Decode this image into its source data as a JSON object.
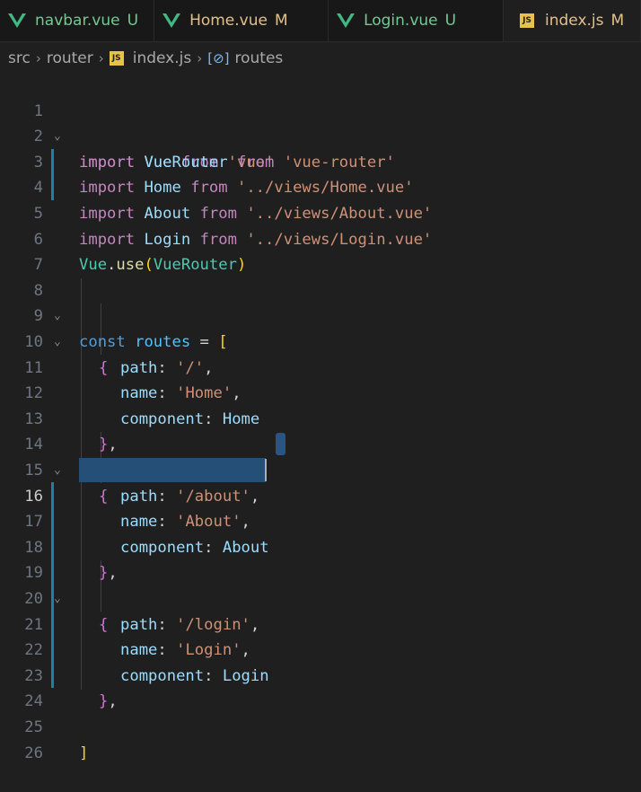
{
  "tabs": [
    {
      "name": "navbar.vue",
      "status": "U",
      "kind": "vue",
      "state": "u"
    },
    {
      "name": "Home.vue",
      "status": "M",
      "kind": "vue",
      "state": "m"
    },
    {
      "name": "Login.vue",
      "status": "U",
      "kind": "vue",
      "state": "u"
    },
    {
      "name": "index.js",
      "status": "M",
      "kind": "js",
      "state": "act"
    }
  ],
  "breadcrumb": {
    "segments": [
      "src",
      "router",
      "index.js",
      "routes"
    ],
    "file_icon": "JS"
  },
  "editor": {
    "current_line": 16,
    "lines": [
      {
        "n": "1"
      },
      {
        "n": "2"
      },
      {
        "n": "3"
      },
      {
        "n": "4"
      },
      {
        "n": "5"
      },
      {
        "n": "6"
      },
      {
        "n": "7"
      },
      {
        "n": "8"
      },
      {
        "n": "9"
      },
      {
        "n": "10"
      },
      {
        "n": "11"
      },
      {
        "n": "12"
      },
      {
        "n": "13"
      },
      {
        "n": "14"
      },
      {
        "n": "15"
      },
      {
        "n": "16"
      },
      {
        "n": "17"
      },
      {
        "n": "18"
      },
      {
        "n": "19"
      },
      {
        "n": "20"
      },
      {
        "n": "21"
      },
      {
        "n": "22"
      },
      {
        "n": "23"
      },
      {
        "n": "24"
      },
      {
        "n": "25"
      },
      {
        "n": "26"
      }
    ],
    "code": {
      "l1": [
        "import",
        " ",
        "Vue",
        " ",
        "from",
        " ",
        "'vue'"
      ],
      "l2": [
        "import",
        " ",
        "VueRouter",
        " ",
        "from",
        " ",
        "'vue-router'"
      ],
      "l3": [
        "import",
        " ",
        "Home",
        " ",
        "from",
        " ",
        "'../views/Home.vue'"
      ],
      "l4": [
        "import",
        " ",
        "About",
        " ",
        "from",
        " ",
        "'../views/About.vue'"
      ],
      "l5": [
        "import",
        " ",
        "Login",
        " ",
        "from",
        " ",
        "'../views/Login.vue'"
      ],
      "l6": [
        "Vue",
        ".",
        "use",
        "(",
        "VueRouter",
        ")"
      ],
      "l8": [
        "const",
        " ",
        "routes",
        " = ",
        "["
      ],
      "l9": [
        "{"
      ],
      "l10": [
        "path",
        ": ",
        "'/'",
        ","
      ],
      "l11": [
        "name",
        ": ",
        "'Home'",
        ","
      ],
      "l12": [
        "component",
        ": ",
        "Home"
      ],
      "l13": [
        "}",
        ","
      ],
      "l14": [
        "{"
      ],
      "l15": [
        "path",
        ": ",
        "'/about'",
        ","
      ],
      "l16": [
        "name",
        ": ",
        "'About'",
        ","
      ],
      "l17": [
        "component",
        ": ",
        "About"
      ],
      "l18": [
        "}",
        ","
      ],
      "l19": [
        "{"
      ],
      "l20": [
        "path",
        ": ",
        "'/login'",
        ","
      ],
      "l21": [
        "name",
        ": ",
        "'Login'",
        ","
      ],
      "l22": [
        "component",
        ": ",
        "Login"
      ],
      "l23": [
        "}",
        ","
      ],
      "l25": [
        "]"
      ]
    }
  },
  "colors": {
    "keyword": "#c586c0",
    "string": "#ce9178",
    "property": "#9cdcfe",
    "selection": "#264f78",
    "modified_gutter": "#1b81a8"
  }
}
